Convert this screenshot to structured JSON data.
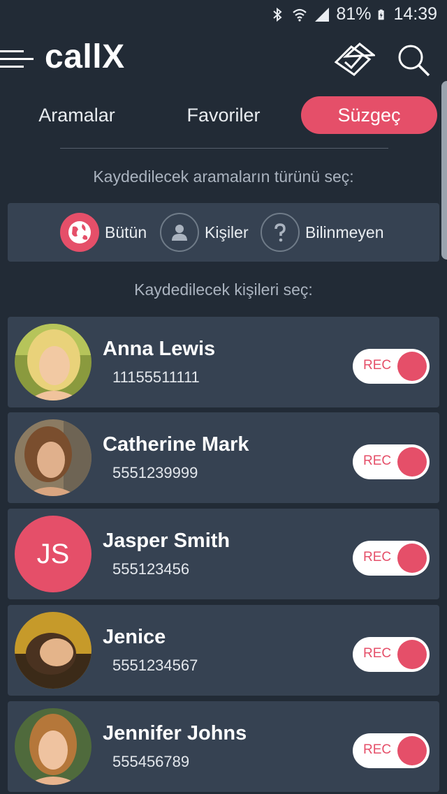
{
  "status_bar": {
    "battery": "81%",
    "time": "14:39"
  },
  "app": {
    "title": "callX"
  },
  "tabs": [
    {
      "label": "Aramalar",
      "active": false
    },
    {
      "label": "Favoriler",
      "active": false
    },
    {
      "label": "Süzgeç",
      "active": true
    }
  ],
  "call_type_section": {
    "heading": "Kaydedilecek aramaların türünü seç:",
    "options": [
      {
        "label": "Bütün",
        "icon": "globe-icon",
        "selected": true
      },
      {
        "label": "Kişiler",
        "icon": "person-icon",
        "selected": false
      },
      {
        "label": "Bilinmeyen",
        "icon": "question-icon",
        "selected": false
      }
    ]
  },
  "contacts_section": {
    "heading": "Kaydedilecek kişileri seç:",
    "contacts": [
      {
        "name": "Anna Lewis",
        "phone": "11155511111",
        "rec_label": "REC",
        "rec_on": true
      },
      {
        "name": "Catherine Mark",
        "phone": "5551239999",
        "rec_label": "REC",
        "rec_on": true
      },
      {
        "name": "Jasper Smith",
        "phone": "555123456",
        "initials": "JS",
        "rec_label": "REC",
        "rec_on": true
      },
      {
        "name": "Jenice",
        "phone": "5551234567",
        "rec_label": "REC",
        "rec_on": true
      },
      {
        "name": "Jennifer Johns",
        "phone": "555456789",
        "rec_label": "REC",
        "rec_on": true
      }
    ]
  },
  "colors": {
    "background": "#222b36",
    "card": "#364252",
    "accent": "#e54f69"
  }
}
